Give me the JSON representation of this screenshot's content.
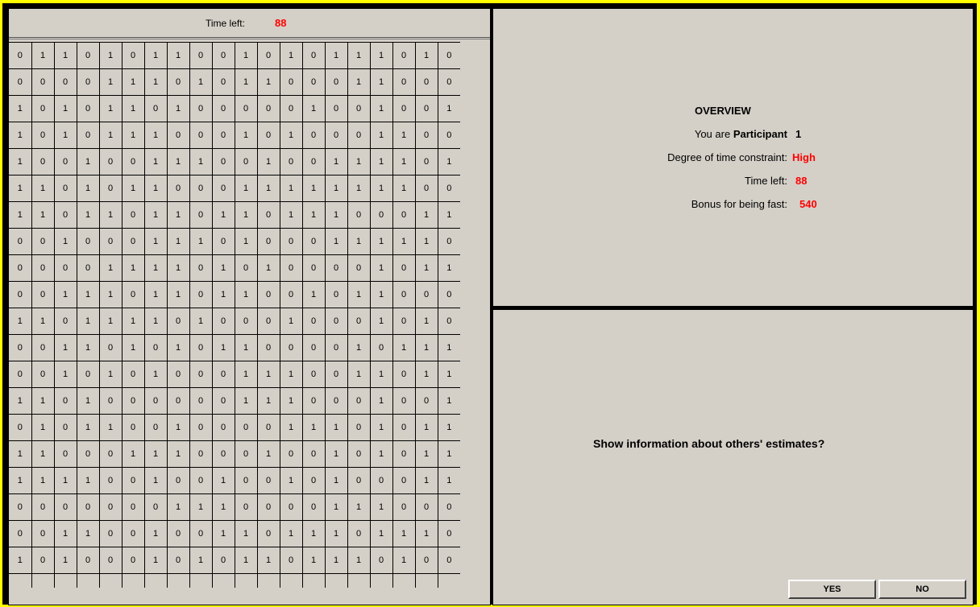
{
  "timer": {
    "label": "Time left:",
    "value": "88"
  },
  "grid": [
    [
      "0",
      "1",
      "1",
      "0",
      "1",
      "0",
      "1",
      "1",
      "0",
      "0",
      "1",
      "0",
      "1",
      "0",
      "1",
      "1",
      "1",
      "0",
      "1",
      "0"
    ],
    [
      "0",
      "0",
      "0",
      "0",
      "1",
      "1",
      "1",
      "0",
      "1",
      "0",
      "1",
      "1",
      "0",
      "0",
      "0",
      "1",
      "1",
      "0",
      "0",
      "0"
    ],
    [
      "1",
      "0",
      "1",
      "0",
      "1",
      "1",
      "0",
      "1",
      "0",
      "0",
      "0",
      "0",
      "0",
      "1",
      "0",
      "0",
      "1",
      "0",
      "0",
      "1"
    ],
    [
      "1",
      "0",
      "1",
      "0",
      "1",
      "1",
      "1",
      "0",
      "0",
      "0",
      "1",
      "0",
      "1",
      "0",
      "0",
      "0",
      "1",
      "1",
      "0",
      "0"
    ],
    [
      "1",
      "0",
      "0",
      "1",
      "0",
      "0",
      "1",
      "1",
      "1",
      "0",
      "0",
      "1",
      "0",
      "0",
      "1",
      "1",
      "1",
      "1",
      "0",
      "1"
    ],
    [
      "1",
      "1",
      "0",
      "1",
      "0",
      "1",
      "1",
      "0",
      "0",
      "0",
      "1",
      "1",
      "1",
      "1",
      "1",
      "1",
      "1",
      "1",
      "0",
      "0"
    ],
    [
      "1",
      "1",
      "0",
      "1",
      "1",
      "0",
      "1",
      "1",
      "0",
      "1",
      "1",
      "0",
      "1",
      "1",
      "1",
      "0",
      "0",
      "0",
      "1",
      "1"
    ],
    [
      "0",
      "0",
      "1",
      "0",
      "0",
      "0",
      "1",
      "1",
      "1",
      "0",
      "1",
      "0",
      "0",
      "0",
      "1",
      "1",
      "1",
      "1",
      "1",
      "0"
    ],
    [
      "0",
      "0",
      "0",
      "0",
      "1",
      "1",
      "1",
      "1",
      "0",
      "1",
      "0",
      "1",
      "0",
      "0",
      "0",
      "0",
      "1",
      "0",
      "1",
      "1"
    ],
    [
      "0",
      "0",
      "1",
      "1",
      "1",
      "0",
      "1",
      "1",
      "0",
      "1",
      "1",
      "0",
      "0",
      "1",
      "0",
      "1",
      "1",
      "0",
      "0",
      "0"
    ],
    [
      "1",
      "1",
      "0",
      "1",
      "1",
      "1",
      "1",
      "0",
      "1",
      "0",
      "0",
      "0",
      "1",
      "0",
      "0",
      "0",
      "1",
      "0",
      "1",
      "0"
    ],
    [
      "0",
      "0",
      "1",
      "1",
      "0",
      "1",
      "0",
      "1",
      "0",
      "1",
      "1",
      "0",
      "0",
      "0",
      "0",
      "1",
      "0",
      "1",
      "1",
      "1"
    ],
    [
      "0",
      "0",
      "1",
      "0",
      "1",
      "0",
      "1",
      "0",
      "0",
      "0",
      "1",
      "1",
      "1",
      "0",
      "0",
      "1",
      "1",
      "0",
      "1",
      "1"
    ],
    [
      "1",
      "1",
      "0",
      "1",
      "0",
      "0",
      "0",
      "0",
      "0",
      "0",
      "1",
      "1",
      "1",
      "0",
      "0",
      "0",
      "1",
      "0",
      "0",
      "1"
    ],
    [
      "0",
      "1",
      "0",
      "1",
      "1",
      "0",
      "0",
      "1",
      "0",
      "0",
      "0",
      "0",
      "1",
      "1",
      "1",
      "0",
      "1",
      "0",
      "1",
      "1"
    ],
    [
      "1",
      "1",
      "0",
      "0",
      "0",
      "1",
      "1",
      "1",
      "0",
      "0",
      "0",
      "1",
      "0",
      "0",
      "1",
      "0",
      "1",
      "0",
      "1",
      "1"
    ],
    [
      "1",
      "1",
      "1",
      "1",
      "0",
      "0",
      "1",
      "0",
      "0",
      "1",
      "0",
      "0",
      "1",
      "0",
      "1",
      "0",
      "0",
      "0",
      "1",
      "1"
    ],
    [
      "0",
      "0",
      "0",
      "0",
      "0",
      "0",
      "0",
      "1",
      "1",
      "1",
      "0",
      "0",
      "0",
      "0",
      "1",
      "1",
      "1",
      "0",
      "0",
      "0"
    ],
    [
      "0",
      "0",
      "1",
      "1",
      "0",
      "0",
      "1",
      "0",
      "0",
      "1",
      "1",
      "0",
      "1",
      "1",
      "1",
      "0",
      "1",
      "1",
      "1",
      "0"
    ],
    [
      "1",
      "0",
      "1",
      "0",
      "0",
      "0",
      "1",
      "0",
      "1",
      "0",
      "1",
      "1",
      "0",
      "1",
      "1",
      "1",
      "0",
      "1",
      "0",
      "0"
    ]
  ],
  "overview": {
    "title": "OVERVIEW",
    "participant_label": "You are",
    "participant_word": "Participant",
    "participant_value": "1",
    "constraint_label": "Degree of time constraint:",
    "constraint_value": "High",
    "time_label": "Time left:",
    "time_value": "88",
    "bonus_label": "Bonus for being fast:",
    "bonus_value": "540"
  },
  "prompt": {
    "question": "Show information about others' estimates?",
    "yes_label": "YES",
    "no_label": "NO"
  },
  "colors": {
    "background": "#ffff00",
    "panel": "#d4d0c8",
    "accent": "#ff0000"
  }
}
